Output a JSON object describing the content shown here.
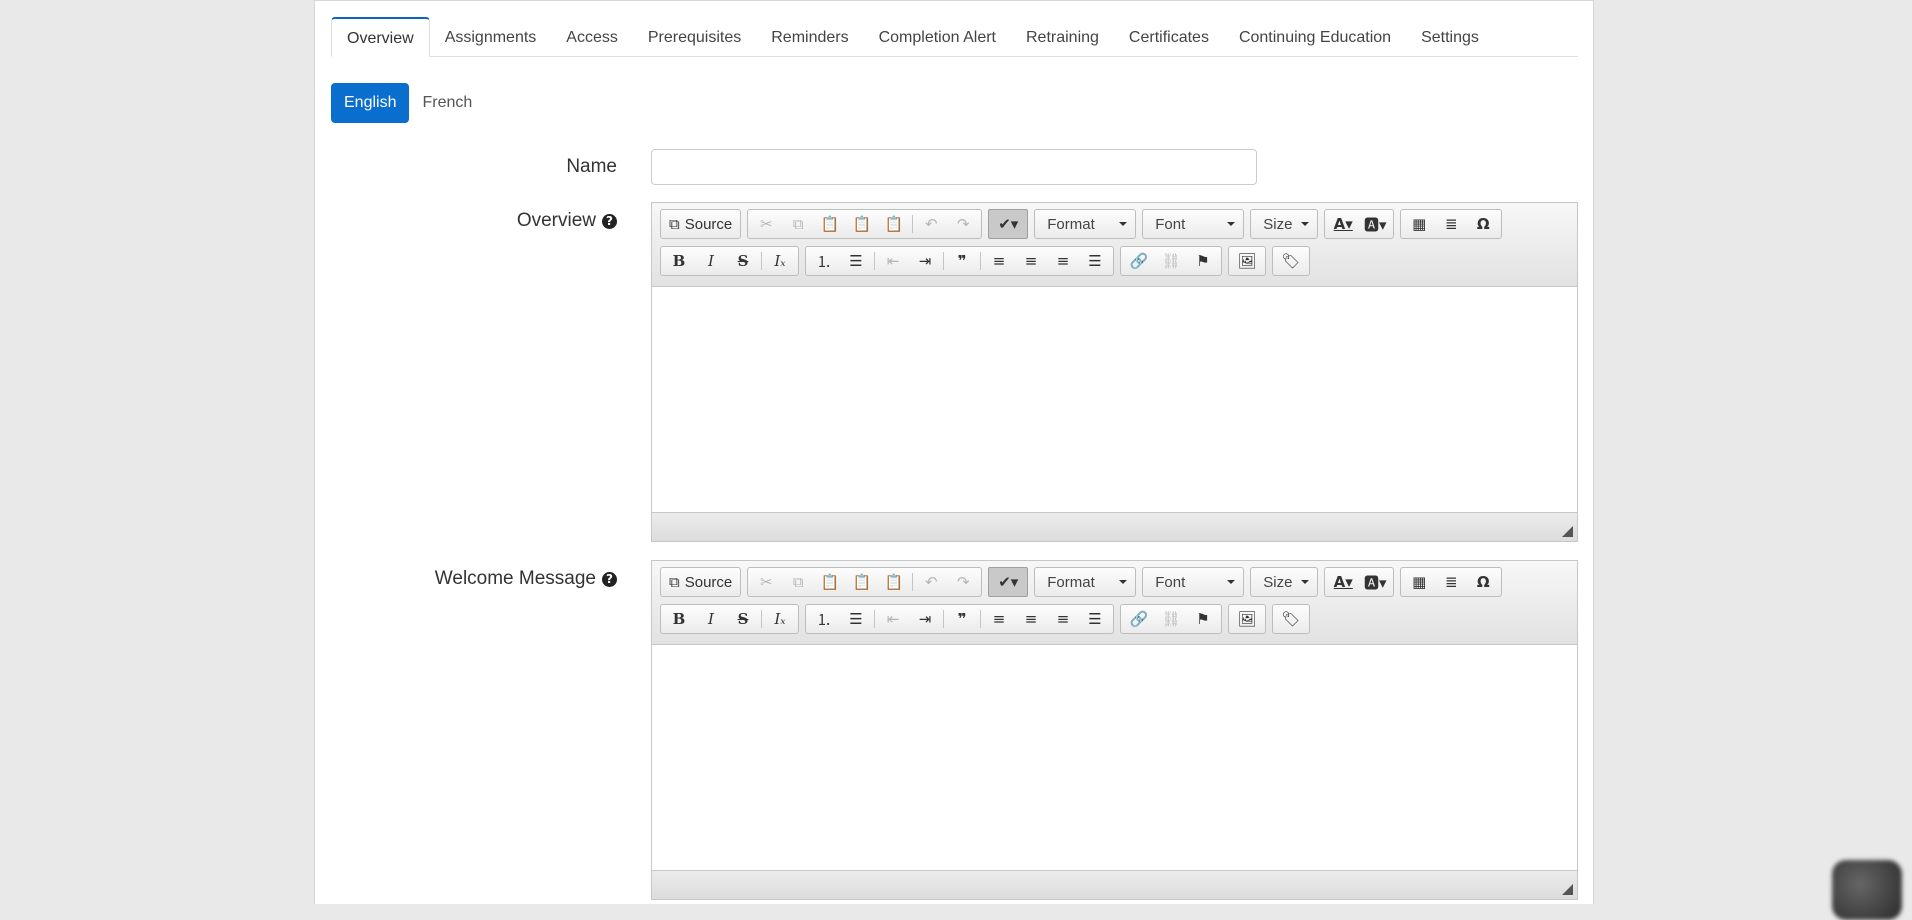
{
  "tabs": [
    {
      "label": "Overview",
      "active": true
    },
    {
      "label": "Assignments"
    },
    {
      "label": "Access"
    },
    {
      "label": "Prerequisites"
    },
    {
      "label": "Reminders"
    },
    {
      "label": "Completion Alert"
    },
    {
      "label": "Retraining"
    },
    {
      "label": "Certificates"
    },
    {
      "label": "Continuing Education"
    },
    {
      "label": "Settings"
    }
  ],
  "languages": [
    {
      "label": "English",
      "active": true
    },
    {
      "label": "French"
    }
  ],
  "form": {
    "name_label": "Name",
    "name_value": "",
    "overview_label": "Overview",
    "welcome_label": "Welcome Message",
    "help_icon": "question-circle-icon"
  },
  "editor_toolbar": {
    "source_label": "Source",
    "format_label": "Format",
    "font_label": "Font",
    "size_label": "Size"
  },
  "colors": {
    "accent": "#0a6ecf",
    "active_tab_border": "#0a66c2",
    "background": "#e9e9e9"
  }
}
